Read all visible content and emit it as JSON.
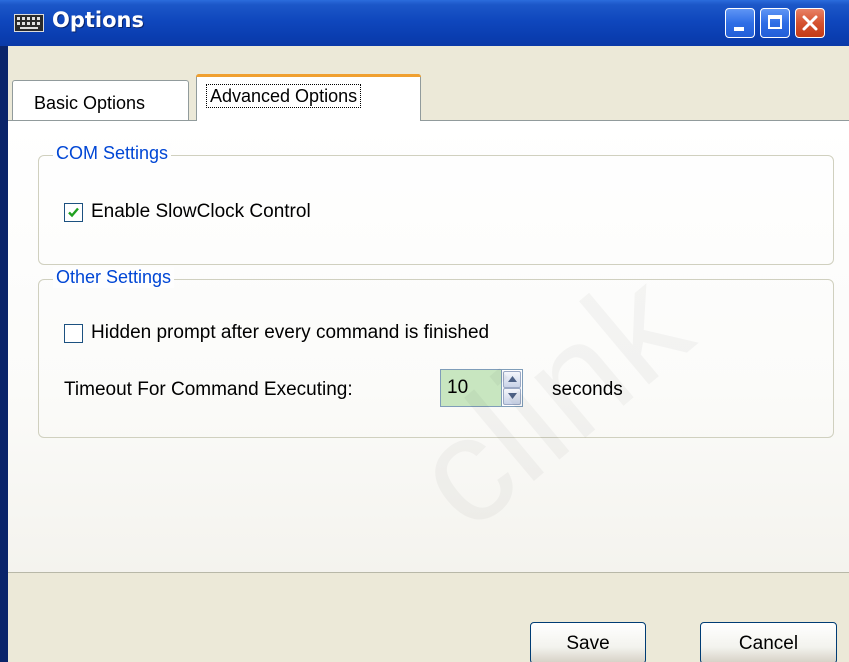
{
  "window": {
    "title": "Options"
  },
  "tabs": [
    {
      "label": "Basic Options",
      "selected": false
    },
    {
      "label": "Advanced Options",
      "selected": true
    }
  ],
  "com_settings": {
    "title": "COM Settings",
    "enable_slowclock": {
      "label": "Enable SlowClock Control",
      "checked": true
    }
  },
  "other_settings": {
    "title": "Other Settings",
    "hidden_prompt": {
      "label": "Hidden prompt after every command is finished",
      "checked": false
    },
    "timeout": {
      "label": "Timeout For Command Executing:",
      "value": "10",
      "unit": "seconds"
    }
  },
  "buttons": {
    "save": "Save",
    "cancel": "Cancel"
  },
  "watermark": "clink",
  "colors": {
    "title_bar": "#0a3db0",
    "group_title": "#0046d5",
    "spin_value_bg": "#c8e6c0",
    "selected_tab_accent": "#f0a030"
  }
}
